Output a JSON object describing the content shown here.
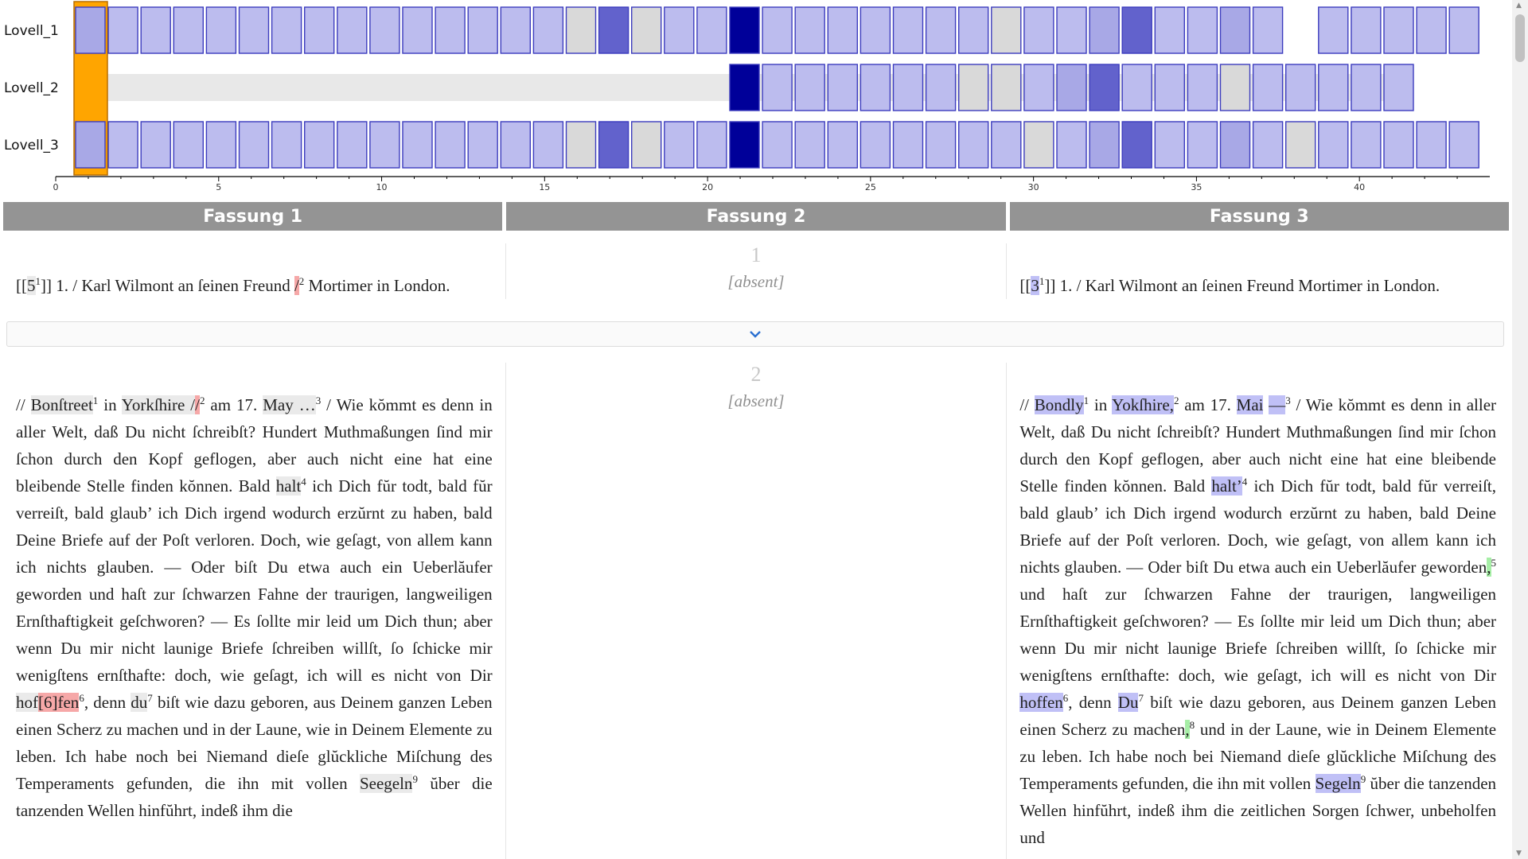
{
  "viz": {
    "rows": [
      "Lovell_1",
      "Lovell_2",
      "Lovell_3"
    ],
    "axis_ticks": [
      0,
      5,
      10,
      15,
      20,
      25,
      30,
      35,
      40
    ],
    "selected_index": 1,
    "colors": {
      "L": "#bcbcee",
      "M": "#a8a8e6",
      "D": "#6262cc",
      "N": "#000099",
      "G": "#d9d9d9",
      "selected": "#ffa500",
      "border": "#3c3cbe",
      "empty_track": "#e8e8e8"
    },
    "cells": [
      "SLLLLLLLLLLLLLLGDGLLNLLLLLLLGLLMDLLMLXLLLLL",
      "SXXXXXXXXXXXXXXXXXXXNLLLLLLGGLMDLLLGLLLLL",
      "SLLLLLLLLLLLLLLGDGLLNLLLLLLLLGLMDLLMLGLLLLL"
    ]
  },
  "headers": [
    "Fassung 1",
    "Fassung 2",
    "Fassung 3"
  ],
  "sections": [
    {
      "number": "1",
      "absent": "[absent]"
    },
    {
      "number": "2",
      "absent": "[absent]"
    }
  ],
  "text": {
    "s1c1_a": "[[",
    "s1c1_b": "5",
    "s1c1_c": "1",
    "s1c1_d": "]] 1. / Karl Wilmont an ſeinen Freund ",
    "s1c1_e": "/",
    "s1c1_f": "2",
    "s1c1_g": " Mortimer in London.",
    "s1c3_a": "[[",
    "s1c3_b": "3",
    "s1c3_c": "1",
    "s1c3_d": "]] 1. / Karl Wilmont an ſeinen Freund Mortimer in London.",
    "s2c1": [
      "// ",
      "Bonſtreet",
      "1",
      " in ",
      "Yorkſhire /",
      "/",
      "2",
      " am 17. ",
      "May …",
      "3",
      " / Wie kŏmmt es denn in aller Welt, daß Du nicht ſchreibſt? Hundert Muthmaßungen ſind mir ſchon durch den Kopf geflogen, aber auch nicht eine hat eine bleibende Stelle finden kŏnnen. Bald ",
      "halt",
      "4",
      " ich Dich fŭr todt, bald fŭr verreiſt, bald glaub’ ich Dich irgend wodurch erzŭrnt zu haben, bald Deine Briefe auf der Poſt verloren. Doch, wie geſagt, von allem kann ich nichts glauben. — Oder biſt Du etwa auch ein Ueberlăufer geworden und haſt zur ſchwarzen Fahne der traurigen, langweiligen Ernſthaftigkeit geſchworen? — Es ſollte mir leid um Dich thun; aber wenn Du mir nicht launige Briefe ſchreiben willſt, ſo ſchicke mir wenigſtens ernſthafte: doch, wie geſagt, ich will es nicht von Dir ",
      "hof",
      "[6]fen",
      "6",
      ", denn ",
      "du",
      "7",
      " biſt wie dazu geboren, aus Deinem ganzen Leben einen Scherz zu machen und in der Laune, wie in Deinem Elemente zu leben. Ich habe noch bei Niemand dieſe glŭckliche Miſchung des Temperaments gefunden, die ihn mit vollen ",
      "Seegeln",
      "9",
      " ŭber die tanzenden Wellen hinfŭhrt, indeß ihm die"
    ],
    "s2c3": [
      "// ",
      "Bondly",
      "1",
      " in ",
      "Yokſhire,",
      "2",
      " am 17. ",
      "Mai",
      " ",
      "—",
      "3",
      " / Wie kŏmmt es denn in aller Welt, daß Du nicht ſchreibſt? Hundert Muthmaßungen ſind mir ſchon durch den Kopf geflogen, aber auch nicht eine hat eine bleibende Stelle finden kŏnnen. Bald ",
      "halt’",
      "4",
      " ich Dich fŭr todt, bald fŭr verreiſt, bald glaub’ ich Dich irgend wodurch erzŭrnt zu haben, bald Deine Briefe auf der Poſt verloren. Doch, wie geſagt, von allem kann ich nichts glauben. — Oder biſt Du etwa auch ein Ueberlăufer geworden",
      ",",
      "5",
      " und haſt zur ſchwarzen Fahne der traurigen, langweiligen Ernſthaftigkeit geſchworen? — Es ſollte mir leid um Dich thun; aber wenn Du mir nicht launige Briefe ſchreiben willſt, ſo ſchicke mir wenigſtens ernſthafte: doch, wie geſagt, ich will es nicht von Dir ",
      "hoffen",
      "6",
      ", denn ",
      "Du",
      "7",
      " biſt wie dazu geboren, aus Deinem ganzen Leben einen Scherz zu machen",
      ",",
      "8",
      " und in der Laune, wie in Deinem Elemente zu leben. Ich habe noch bei Niemand dieſe glŭckliche Miſchung des Temperaments gefunden, die ihn mit vollen ",
      "Segeln",
      "9",
      " ŭber die tanzenden Wellen hinfŭhrt, indeß ihm die zeitlichen Sorgen ſchwer, unbeholfen und"
    ]
  },
  "expander_icon": "chevron-down-icon",
  "scrollbar": {
    "up_icon": "▲",
    "down_icon": "▼"
  }
}
